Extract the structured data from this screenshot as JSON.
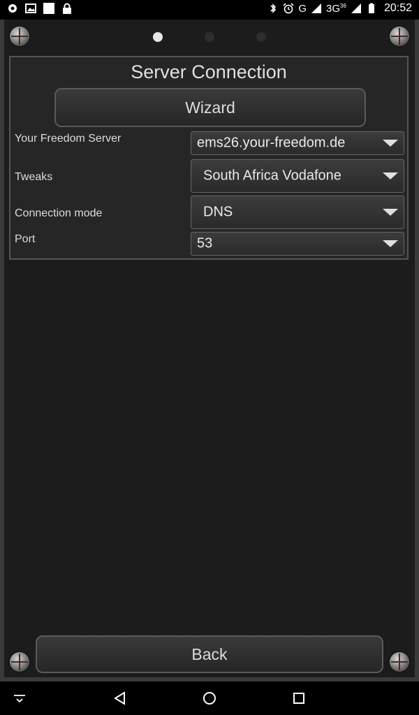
{
  "status_bar": {
    "left_icons": [
      "notification-dot-icon",
      "image-icon",
      "square-icon",
      "lock-icon"
    ],
    "right_icons": [
      "bluetooth-icon",
      "alarm-icon",
      "signal-icon",
      "battery-icon"
    ],
    "network_g": "G",
    "network_3g": "3G",
    "network_3g_sup": "36",
    "time": "20:52"
  },
  "pager": {
    "total": 3,
    "active_index": 0
  },
  "panel": {
    "title": "Server Connection",
    "wizard_label": "Wizard",
    "rows": [
      {
        "label": "Your Freedom Server",
        "value": "ems26.your-freedom.de"
      },
      {
        "label": "Tweaks",
        "value": "South Africa Vodafone"
      },
      {
        "label": "Connection mode",
        "value": "DNS"
      },
      {
        "label": "Port",
        "value": "53"
      }
    ]
  },
  "footer": {
    "back_label": "Back"
  },
  "nav_bar": {
    "icons": [
      "keyboard-hide-icon",
      "back-triangle-icon",
      "home-circle-icon",
      "recents-square-icon"
    ]
  }
}
